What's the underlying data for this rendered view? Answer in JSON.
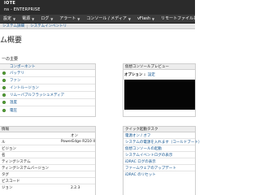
{
  "brand": {
    "line1": "IOTE",
    "line2": "ns - ENTERPRISE"
  },
  "nav": {
    "items": [
      {
        "label": "設定",
        "has_menu": false
      },
      {
        "label": "電源",
        "has_menu": false
      },
      {
        "label": "ログ",
        "has_menu": false
      },
      {
        "label": "アラート",
        "has_menu": false
      },
      {
        "label": "コンソール / メディア",
        "has_menu": false
      },
      {
        "label": "vFlash",
        "has_menu": false
      },
      {
        "label": "リモートファイル共有",
        "has_menu": false
      }
    ]
  },
  "subnav": {
    "items": [
      "システム詳細",
      "システムインベントリ"
    ]
  },
  "page": {
    "title": "ム概要"
  },
  "summary": {
    "section_label": "ーの主要",
    "column_header": "コンポーネント",
    "rows": [
      "バッテリ",
      "ファン",
      "イントルージョン",
      "リムーバブルフラッシュメディア",
      "温度",
      "電圧"
    ]
  },
  "console_preview": {
    "header": "仮想コンソールプレビュー",
    "options_label": "オプション :",
    "options_link": "設定",
    "screen_color": "#050505"
  },
  "info": {
    "header": "情報",
    "rows": [
      {
        "label": "",
        "value": "オン"
      },
      {
        "label": "ル",
        "value": "PowerEdge R210 II"
      },
      {
        "label": "ビジョン",
        "value": ""
      },
      {
        "label": "名",
        "value": ""
      },
      {
        "label": "ティングシステム",
        "value": ""
      },
      {
        "label": "ティングシステムバージョン",
        "value": ""
      },
      {
        "label": "タグ",
        "value": ""
      },
      {
        "label": "ビスコード",
        "value": ""
      },
      {
        "label": "ジョン",
        "value": "2.2.3"
      }
    ]
  },
  "quick_tasks": {
    "header": "クイック起動タスク",
    "rows": [
      "電源オン / オフ",
      "システムの電源を入れます（コールドブート）",
      "仮想コンソールの起動",
      "システムイベントログの表示",
      "iDRAC ログの表示",
      "ファームウェアのアップデート",
      "iDRAC のリセット"
    ]
  },
  "colors": {
    "banner": "#2b2b2b",
    "nav": "#3c3c3c",
    "link": "#0b4f8c",
    "status_ok": "#5cab3c"
  }
}
